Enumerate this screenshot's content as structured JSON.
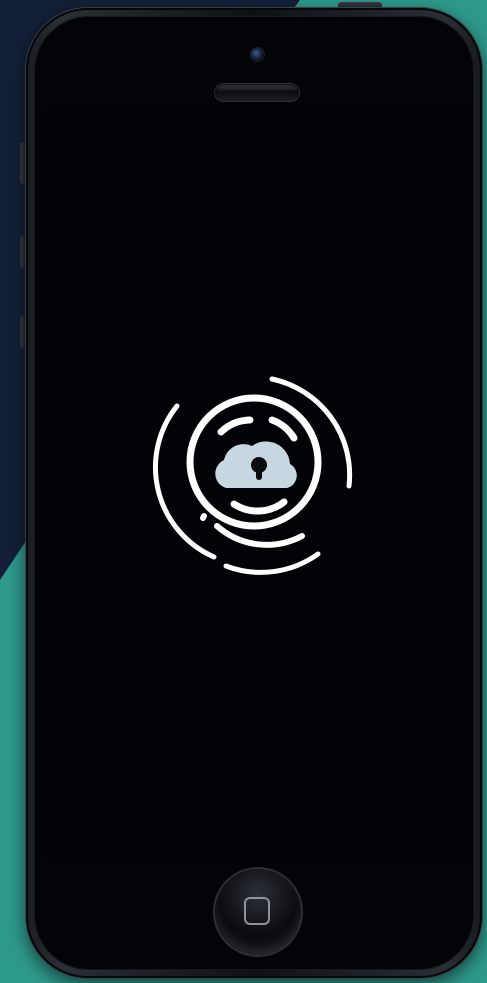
{
  "device": {
    "model": "smartphone",
    "screen_state": "lock-screen"
  },
  "lock_screen": {
    "icon": "cloud-lock-icon",
    "ring_color": "#ffffff",
    "cloud_color": "#c6d7e2",
    "keyhole_color": "#0a0b0f"
  },
  "colors": {
    "background_dark": "#132038",
    "background_teal": "#2e9a8c",
    "screen": "#020307"
  }
}
